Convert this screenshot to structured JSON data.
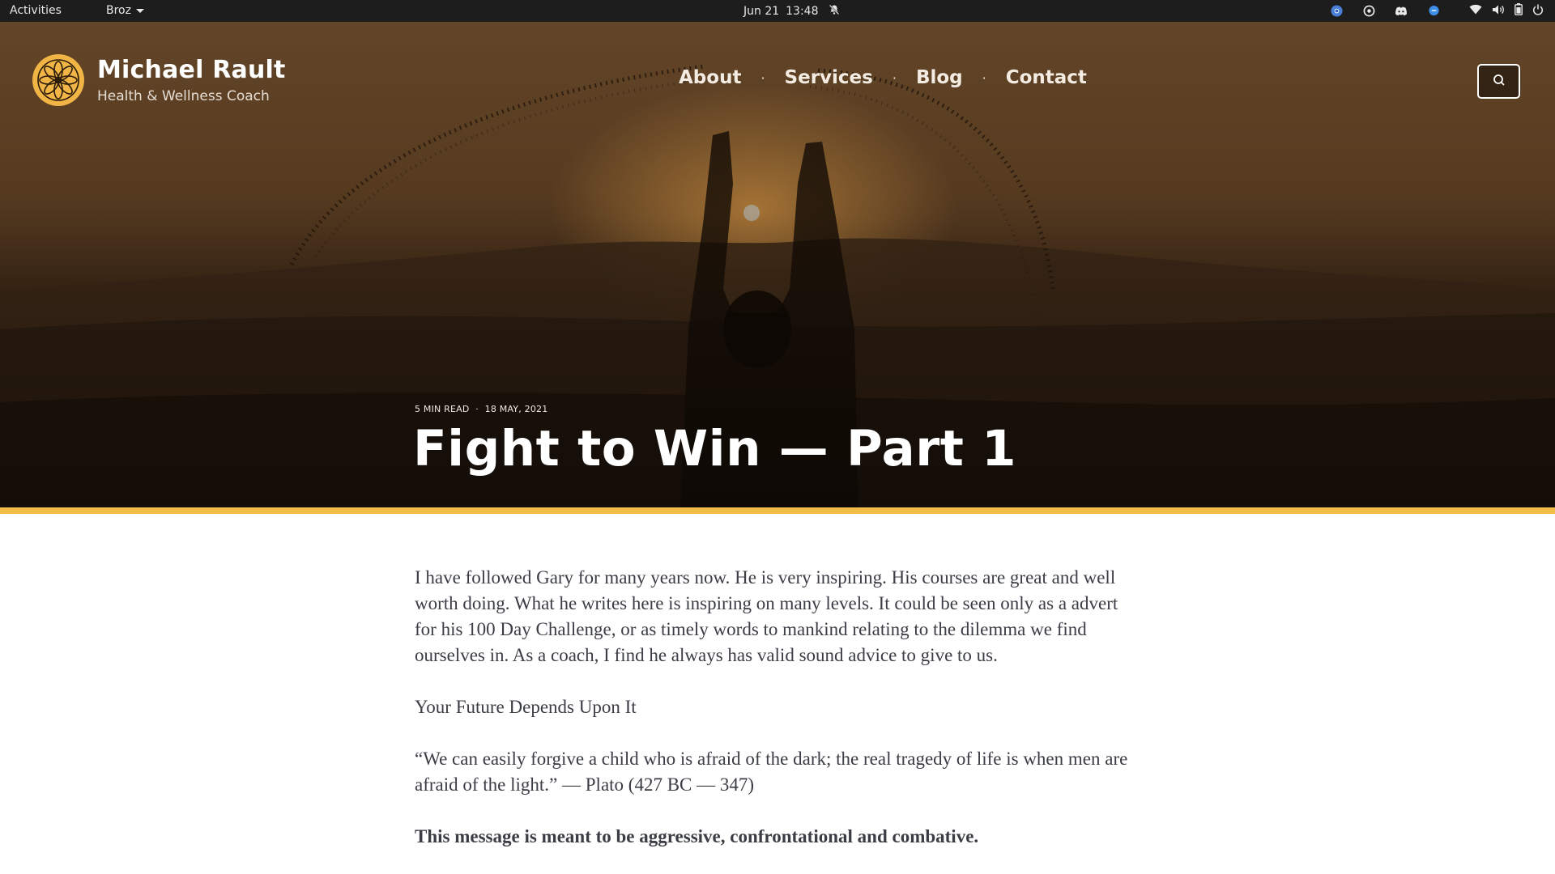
{
  "topbar": {
    "activities": "Activities",
    "app_menu": "Broz",
    "date": "Jun 21",
    "time": "13:48",
    "icons": [
      "notifications-muted-icon",
      "chrome-icon",
      "tray-app-icon",
      "discord-icon",
      "chat-icon",
      "wifi-icon",
      "volume-icon",
      "battery-icon",
      "power-icon"
    ]
  },
  "site": {
    "name": "Michael Rault",
    "tagline": "Health & Wellness Coach",
    "nav": [
      "About",
      "Services",
      "Blog",
      "Contact"
    ],
    "nav_separator": "·",
    "accent_color": "#f3bc47"
  },
  "post": {
    "read_time": "5 MIN READ",
    "date": "18 MAY, 2021",
    "meta_separator": "·",
    "title": "Fight to Win — Part 1",
    "paragraphs": [
      "I have followed Gary for many years now. He is very inspiring. His courses are great and well worth doing. What he writes here is inspiring on many levels. It could be seen only as a advert for his 100 Day Challenge, or as timely words to mankind relating to the dilemma we find ourselves in. As a coach, I find he always has valid sound advice to give to us.",
      "Your Future Depends Upon It",
      "“We can easily forgive a child who is afraid of the dark; the real tragedy of life is when men are afraid of the light.” — Plato (427 BC — 347)",
      "This message is meant to be aggressive, confrontational and combative."
    ]
  }
}
